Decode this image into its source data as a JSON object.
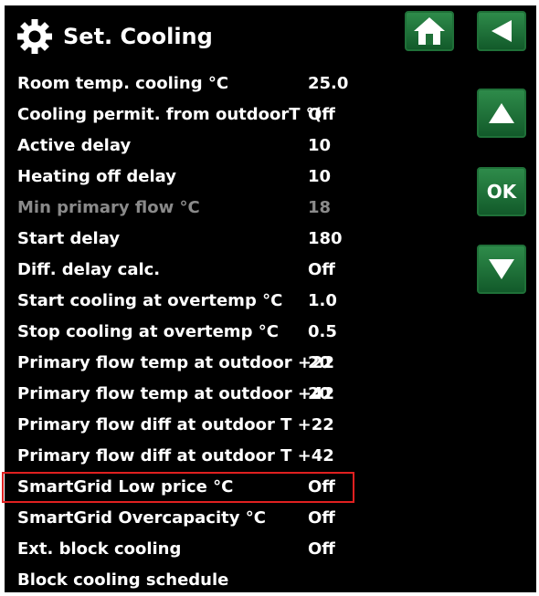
{
  "header": {
    "title": "Set. Cooling"
  },
  "nav": {
    "home_icon": "home-icon",
    "back_icon": "back-arrow-icon",
    "up_icon": "up-arrow-icon",
    "ok_label": "OK",
    "down_icon": "down-arrow-icon"
  },
  "rows": [
    {
      "label": "Room temp. cooling °C",
      "value": "25.0"
    },
    {
      "label": "Cooling permit. from outdoorT °(",
      "value": "Off"
    },
    {
      "label": "Active delay",
      "value": "10"
    },
    {
      "label": "Heating off delay",
      "value": "10"
    },
    {
      "label": "Min primary flow °C",
      "value": "18"
    },
    {
      "label": "Start delay",
      "value": "180"
    },
    {
      "label": "Diff. delay calc.",
      "value": "Off"
    },
    {
      "label": "Start cooling at overtemp °C",
      "value": "1.0"
    },
    {
      "label": "Stop cooling at overtemp °C",
      "value": "0.5"
    },
    {
      "label": "Primary flow temp at outdoor +22",
      "value": "20"
    },
    {
      "label": "Primary flow temp at outdoor +42",
      "value": "20"
    },
    {
      "label": "Primary flow diff at outdoor T +22",
      "value": ""
    },
    {
      "label": "Primary flow diff at outdoor T +42",
      "value": ""
    },
    {
      "label": "SmartGrid Low price °C",
      "value": "Off"
    },
    {
      "label": "SmartGrid Overcapacity °C",
      "value": "Off"
    },
    {
      "label": "Ext. block cooling",
      "value": "Off"
    },
    {
      "label": "Block cooling schedule",
      "value": ""
    }
  ],
  "colors": {
    "accent": "#2e8b4a",
    "highlight": "#e02020",
    "disabled": "#8a8a8a"
  }
}
